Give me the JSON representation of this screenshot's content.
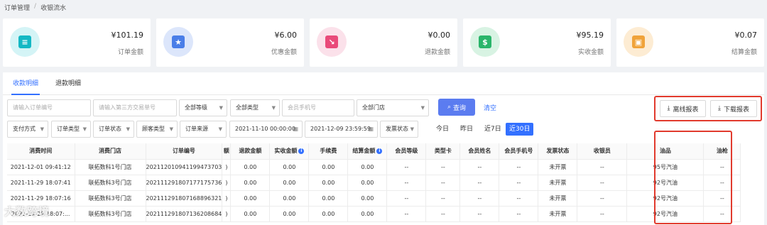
{
  "breadcrumb": [
    "订单管理",
    "收银流水"
  ],
  "breadcrumb_sep": "/",
  "stats": [
    {
      "amount": "¥101.19",
      "label": "订单金额",
      "color": "#14b8c4",
      "bg": "#d4f4f6",
      "icon": "clipboard-icon",
      "glyph": "≡"
    },
    {
      "amount": "¥6.00",
      "label": "优惠金额",
      "color": "#4a7ee8",
      "bg": "#dce6fb",
      "icon": "ticket-icon",
      "glyph": "★"
    },
    {
      "amount": "¥0.00",
      "label": "退款金额",
      "color": "#e94a7a",
      "bg": "#fbe1ea",
      "icon": "trend-down-icon",
      "glyph": "↘"
    },
    {
      "amount": "¥95.19",
      "label": "实收金额",
      "color": "#2ab56a",
      "bg": "#d8f3e3",
      "icon": "cash-icon",
      "glyph": "$"
    },
    {
      "amount": "¥0.07",
      "label": "结算金额",
      "color": "#f0a33a",
      "bg": "#fdecd3",
      "icon": "wallet-icon",
      "glyph": "▣"
    }
  ],
  "tabs": [
    "收款明细",
    "退款明细"
  ],
  "filters": {
    "order_no_placeholder": "请输入订单编号",
    "third_party_placeholder": "请输入第三方交易单号",
    "level": "全部等级",
    "type": "全部类型",
    "phone_placeholder": "会员手机号",
    "store": "全部门店",
    "pay_method": "支付方式",
    "order_type": "订单类型",
    "order_status": "订单状态",
    "customer_type": "顾客类型",
    "order_source": "订单来源",
    "start_time": "2021-11-10 00:00:00",
    "end_time": "2021-12-09 23:59:59",
    "invoice_status": "发票状态"
  },
  "search_label": "查询",
  "clear_label": "清空",
  "offline_report_label": "离线报表",
  "download_report_label": "下载报表",
  "ranges": [
    "今日",
    "昨日",
    "近7日",
    "近30日"
  ],
  "table": {
    "headers": [
      "消费时间",
      "消费门店",
      "订单编号",
      "额",
      "退款金额",
      "实收金额",
      "手续费",
      "结算金额",
      "会员等级",
      "类型卡",
      "会员姓名",
      "会员手机号",
      "发票状态",
      "收银员",
      "油品",
      "油枪"
    ],
    "info_cols": [
      5,
      7
    ],
    "rows": [
      [
        "2021-12-01 09:41:12",
        "联拓数科1号门店",
        "202112010941199473703",
        ")",
        "0.00",
        "0.00",
        "0.00",
        "0.00",
        "--",
        "--",
        "--",
        "--",
        "未开票",
        "--",
        "95号汽油",
        "--"
      ],
      [
        "2021-11-29 18:07:41",
        "联拓数科3号门店",
        "202111291807177175736",
        ")",
        "0.00",
        "0.00",
        "0.00",
        "0.00",
        "--",
        "--",
        "--",
        "--",
        "未开票",
        "--",
        "92号汽油",
        "--"
      ],
      [
        "2021-11-29 18:07:16",
        "联拓数科3号门店",
        "202111291807168896321",
        ")",
        "0.00",
        "0.00",
        "0.00",
        "0.00",
        "--",
        "--",
        "--",
        "--",
        "未开票",
        "--",
        "92号汽油",
        "--"
      ],
      [
        "2021-11-29 18:07:...",
        "联拓数科3号门店",
        "202111291807136208684",
        ")",
        "0.00",
        "0.00",
        "0.00",
        "0.00",
        "--",
        "--",
        "--",
        "--",
        "未开票",
        "--",
        "92号汽油",
        "--"
      ]
    ]
  },
  "watermark": "大数跨境",
  "accent": "#3370ff",
  "highlight": "#e13a2d"
}
